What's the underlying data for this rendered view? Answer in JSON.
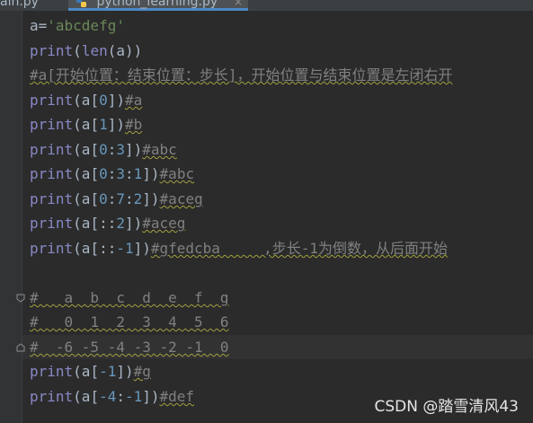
{
  "tabs": [
    {
      "label": "ain.py"
    },
    {
      "label": "python_learning.py",
      "close": "×"
    }
  ],
  "code_lines": [
    "a='abcdefg'",
    "print(len(a))",
    "#a[开始位置：结束位置：步长]，开始位置与结束位置是左闭右开",
    "print(a[0])#a",
    "print(a[1])#b",
    "print(a[0:3])#abc",
    "print(a[0:3:1])#abc",
    "print(a[0:7:2])#aceg",
    "print(a[::2])#aceg",
    "print(a[::-1])#gfedcba     ,步长-1为倒数，从后面开始",
    "",
    "#   a  b  c  d  e  f  g",
    "#   0  1  2  3  4  5  6",
    "#  -6 -5 -4 -3 -2 -1  0",
    "print(a[-1])#g",
    "print(a[-4:-1])#def"
  ],
  "watermark": "CSDN @踏雪清风43",
  "colors": {
    "background": "#2b2b2b",
    "keyword": "#8888c6",
    "string": "#6a8759",
    "number": "#6897bb",
    "comment": "#808080",
    "text": "#a9b7c6"
  },
  "icons": [
    "python-file-icon",
    "close-icon",
    "fold-marker-icon"
  ]
}
